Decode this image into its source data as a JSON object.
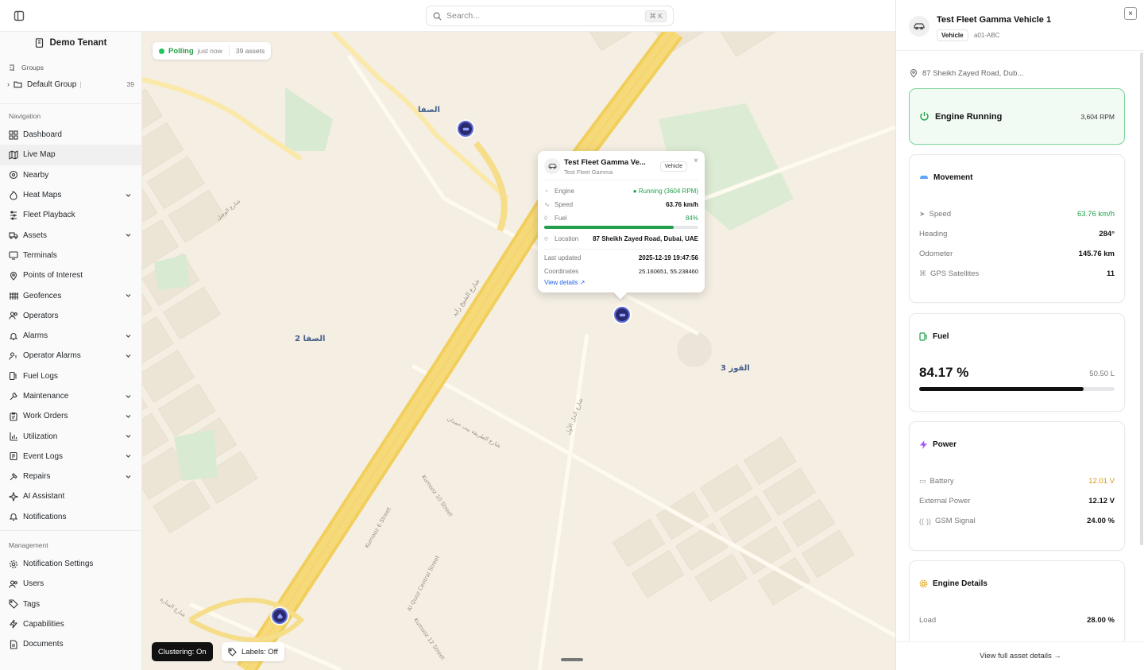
{
  "search": {
    "placeholder": "Search...",
    "shortcut": "⌘ K"
  },
  "sidebar": {
    "tenant": "Demo Tenant",
    "groups_label": "Groups",
    "group": {
      "name": "Default Group",
      "count": "39"
    },
    "navigation_label": "Navigation",
    "nav_items": [
      {
        "label": "Dashboard",
        "icon": "dashboard-icon",
        "chevron": false
      },
      {
        "label": "Live Map",
        "icon": "map-icon",
        "chevron": false,
        "active": true
      },
      {
        "label": "Nearby",
        "icon": "radar-icon",
        "chevron": false
      },
      {
        "label": "Heat Maps",
        "icon": "flame-icon",
        "chevron": true
      },
      {
        "label": "Fleet Playback",
        "icon": "playback-icon",
        "chevron": false
      },
      {
        "label": "Assets",
        "icon": "truck-icon",
        "chevron": true
      },
      {
        "label": "Terminals",
        "icon": "terminal-icon",
        "chevron": false
      },
      {
        "label": "Points of Interest",
        "icon": "pin-icon",
        "chevron": false
      },
      {
        "label": "Geofences",
        "icon": "fence-icon",
        "chevron": true
      },
      {
        "label": "Operators",
        "icon": "users-icon",
        "chevron": false
      },
      {
        "label": "Alarms",
        "icon": "bell-icon",
        "chevron": true
      },
      {
        "label": "Operator Alarms",
        "icon": "user-alert-icon",
        "chevron": true
      },
      {
        "label": "Fuel Logs",
        "icon": "fuel-icon",
        "chevron": false
      },
      {
        "label": "Maintenance",
        "icon": "wrench-icon",
        "chevron": true
      },
      {
        "label": "Work Orders",
        "icon": "clipboard-icon",
        "chevron": true
      },
      {
        "label": "Utilization",
        "icon": "bar-chart-icon",
        "chevron": true
      },
      {
        "label": "Event Logs",
        "icon": "log-icon",
        "chevron": true
      },
      {
        "label": "Repairs",
        "icon": "hammer-icon",
        "chevron": true
      },
      {
        "label": "AI Assistant",
        "icon": "sparkle-icon",
        "chevron": false
      },
      {
        "label": "Notifications",
        "icon": "bell-icon",
        "chevron": false
      }
    ],
    "management_label": "Management",
    "mgmt_items": [
      {
        "label": "Notification Settings",
        "icon": "settings-icon"
      },
      {
        "label": "Users",
        "icon": "users-icon"
      },
      {
        "label": "Tags",
        "icon": "tag-icon"
      },
      {
        "label": "Capabilities",
        "icon": "zap-icon"
      },
      {
        "label": "Documents",
        "icon": "document-icon"
      }
    ]
  },
  "map": {
    "polling": {
      "status": "Polling",
      "time": "just now",
      "assets": "39 assets"
    },
    "area_labels": [
      "الصفا",
      "الصفا 2",
      "القوز 3"
    ],
    "street_labels": [
      "شارع الشيخ زايد",
      "شارع الوصل",
      "شارع الطريقة بنت حمدان",
      "شارع الحل الأول",
      "Kumooz 10 Street",
      "Kumooz 6 Street",
      "Al Quoz Central Street",
      "Kumooz 12 Street",
      "شارع المنارة"
    ],
    "clustering": "Clustering: On",
    "labels": "Labels: Off",
    "popup": {
      "title": "Test Fleet Gamma Ve...",
      "subtitle": "Test Fleet Gamma",
      "badge": "Vehicle",
      "engine_label": "Engine",
      "engine_value": "Running (3604 RPM)",
      "speed_label": "Speed",
      "speed_value": "63.76 km/h",
      "fuel_label": "Fuel",
      "fuel_value": "84%",
      "fuel_fraction": 0.84,
      "location_label": "Location",
      "location_value": "87 Sheikh Zayed Road, Dubai, UAE",
      "updated_label": "Last updated",
      "updated_value": "2025-12-19 19:47:56",
      "coords_label": "Coordinates",
      "coords_value": "25.160651, 55.238460",
      "view_details": "View details"
    }
  },
  "panel": {
    "title": "Test Fleet Gamma Vehicle 1",
    "type_badge": "Vehicle",
    "plate": "a01-ABC",
    "address": "87 Sheikh Zayed Road, Dub...",
    "engine": {
      "label": "Engine Running",
      "rpm": "3,604 RPM"
    },
    "movement": {
      "title": "Movement",
      "speed_label": "Speed",
      "speed": "63.76 km/h",
      "heading_label": "Heading",
      "heading": "284°",
      "odometer_label": "Odometer",
      "odometer": "145.76 km",
      "gps_label": "GPS Satellites",
      "gps": "11"
    },
    "fuel": {
      "title": "Fuel",
      "percent": "84.17 %",
      "liters": "50.50 L",
      "fraction": 0.8417
    },
    "power": {
      "title": "Power",
      "battery_label": "Battery",
      "battery": "12.01 V",
      "ext_label": "External Power",
      "ext": "12.12 V",
      "gsm_label": "GSM Signal",
      "gsm": "24.00 %"
    },
    "engine_details": {
      "title": "Engine Details",
      "load_label": "Load",
      "load": "28.00 %"
    },
    "footer": "View full asset details →"
  },
  "colors": {
    "accent_green": "#22a04b",
    "marker": "#2b2a6e",
    "amber": "#d89a0b",
    "map_bg": "#f5efe4",
    "road": "#f3d77a"
  }
}
